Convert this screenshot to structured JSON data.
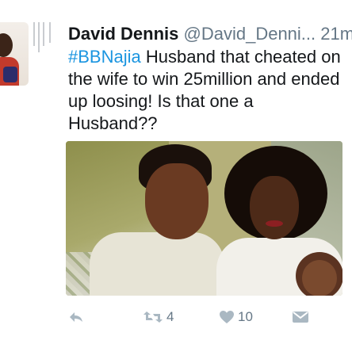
{
  "tweet": {
    "author_name": "David Dennis",
    "author_handle": "@David_Denni...",
    "time": "21m",
    "hashtag": "#BBNajia",
    "text_rest": " Husband that cheated on the wife to win 25million and ended up loosing! Is that one a Husband??"
  },
  "actions": {
    "reply_icon": "reply-icon",
    "retweet_icon": "retweet-icon",
    "retweet_count": "4",
    "like_icon": "heart-icon",
    "like_count": "10",
    "dm_icon": "direct-message-icon"
  },
  "colors": {
    "hashtag": "#1b95e0",
    "icon_gray": "#aab8c2",
    "text": "#14171a",
    "secondary": "#657786"
  }
}
